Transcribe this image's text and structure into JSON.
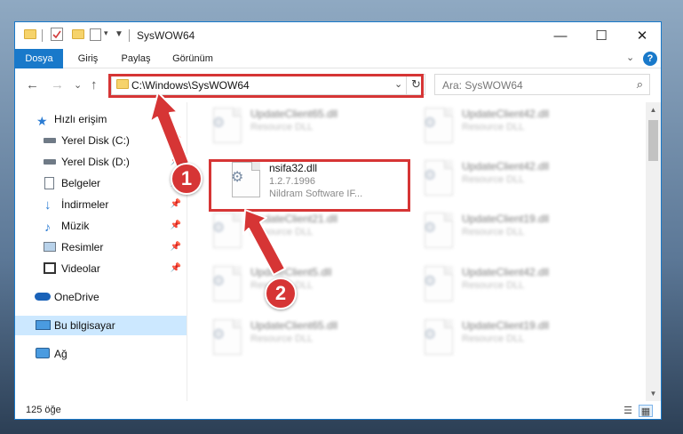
{
  "window": {
    "title": "SysWOW64",
    "controls": {
      "minimize": "—",
      "maximize": "☐",
      "close": "✕"
    }
  },
  "ribbon": {
    "tabs": [
      "Dosya",
      "Giriş",
      "Paylaş",
      "Görünüm"
    ],
    "expand": "⌄",
    "help": "?"
  },
  "nav": {
    "back": "←",
    "forward": "→",
    "recent": "⌄",
    "up": "↑",
    "address": "C:\\Windows\\SysWOW64",
    "address_dropdown": "⌄",
    "refresh": "↻",
    "search_placeholder": "Ara: SysWOW64",
    "search_icon": "⌕"
  },
  "sidebar": {
    "items": [
      {
        "label": "Hızlı erişim",
        "icon": "star-icon",
        "pinned": false
      },
      {
        "label": "Yerel Disk (C:)",
        "icon": "drive-icon",
        "pinned": true
      },
      {
        "label": "Yerel Disk (D:)",
        "icon": "drive-icon",
        "pinned": true
      },
      {
        "label": "Belgeler",
        "icon": "document-icon",
        "pinned": true
      },
      {
        "label": "İndirmeler",
        "icon": "download-icon",
        "pinned": true
      },
      {
        "label": "Müzik",
        "icon": "music-icon",
        "pinned": true
      },
      {
        "label": "Resimler",
        "icon": "pictures-icon",
        "pinned": true
      },
      {
        "label": "Videolar",
        "icon": "video-icon",
        "pinned": true
      },
      {
        "label": "OneDrive",
        "icon": "cloud-icon",
        "pinned": false
      },
      {
        "label": "Bu bilgisayar",
        "icon": "computer-icon",
        "pinned": false,
        "selected": true
      },
      {
        "label": "Ağ",
        "icon": "network-icon",
        "pinned": false
      }
    ],
    "pin_glyph": "📌"
  },
  "files": {
    "highlighted": {
      "name": "nsifa32.dll",
      "version": "1.2.7.1996",
      "company": "Nildram Software IF..."
    },
    "background": [
      {
        "name": "UpdateClient65.dll",
        "type": "Resource DLL"
      },
      {
        "name": "UpdateClient42.dll",
        "type": "Resource DLL"
      },
      {
        "name": "UpdateClient42.dll",
        "type": "Resource DLL"
      },
      {
        "name": "UpdateClient21.dll",
        "type": "Resource DLL"
      },
      {
        "name": "UpdateClient19.dll",
        "type": "Resource DLL"
      },
      {
        "name": "UpdateClient5.dll",
        "type": "Resource DLL"
      },
      {
        "name": "UpdateClient42.dll",
        "type": "Resource DLL"
      },
      {
        "name": "UpdateClient65.dll",
        "type": "Resource DLL"
      },
      {
        "name": "UpdateClient19.dll",
        "type": "Resource DLL"
      }
    ]
  },
  "status": {
    "item_count": "125 öğe"
  },
  "annotations": {
    "step1": "1",
    "step2": "2",
    "color": "#d63535"
  }
}
